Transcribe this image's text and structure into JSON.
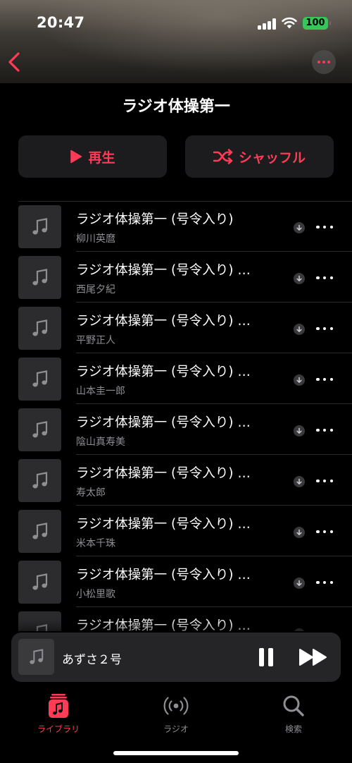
{
  "status": {
    "time": "20:47",
    "battery": "100"
  },
  "header": {
    "title": "ラジオ体操第一"
  },
  "actions": {
    "play_label": "再生",
    "shuffle_label": "シャッフル"
  },
  "tracks": [
    {
      "title": "ラジオ体操第一 (号令入り)",
      "artist": "柳川英麿"
    },
    {
      "title": "ラジオ体操第一 (号令入り) …",
      "artist": "西尾夕紀"
    },
    {
      "title": "ラジオ体操第一 (号令入り) …",
      "artist": "平野正人"
    },
    {
      "title": "ラジオ体操第一 (号令入り) …",
      "artist": "山本圭一郎"
    },
    {
      "title": "ラジオ体操第一 (号令入り) …",
      "artist": "陰山真寿美"
    },
    {
      "title": "ラジオ体操第一 (号令入り) …",
      "artist": "寿太郎"
    },
    {
      "title": "ラジオ体操第一 (号令入り) …",
      "artist": "米本千珠"
    },
    {
      "title": "ラジオ体操第一 (号令入り) …",
      "artist": "小松里歌"
    },
    {
      "title": "ラジオ体操第一 (号令入り) …",
      "artist": ""
    }
  ],
  "now_playing": {
    "title": "あずさ２号"
  },
  "tabs": [
    {
      "label": "ライブラリ",
      "icon": "library-icon",
      "active": true
    },
    {
      "label": "ラジオ",
      "icon": "radio-icon",
      "active": false
    },
    {
      "label": "検索",
      "icon": "search-icon",
      "active": false
    }
  ],
  "colors": {
    "accent": "#ff3b56",
    "background": "#000000",
    "card": "#1c1c1e",
    "battery": "#34c759"
  }
}
